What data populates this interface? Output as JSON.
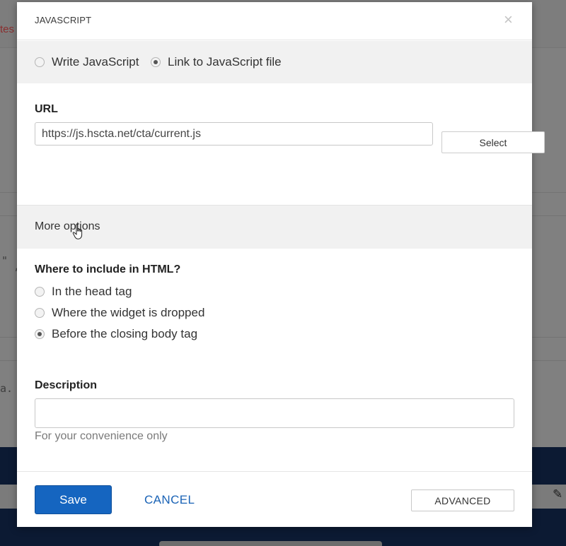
{
  "background": {
    "partial_text": "tes",
    "glyph_quote": "\"",
    "glyph_comma": ",",
    "glyph_a": "a."
  },
  "modal": {
    "title": "JAVASCRIPT",
    "close_glyph": "×",
    "source_options": [
      {
        "label": "Write JavaScript",
        "checked": false
      },
      {
        "label": "Link to JavaScript file",
        "checked": true
      }
    ],
    "url": {
      "label": "URL",
      "value": "https://js.hscta.net/cta/current.js"
    },
    "select_button": "Select",
    "more_options": "More options",
    "include": {
      "label": "Where to include in HTML?",
      "options": [
        {
          "label": "In the head tag",
          "checked": false
        },
        {
          "label": "Where the widget is dropped",
          "checked": false
        },
        {
          "label": "Before the closing body tag",
          "checked": true
        }
      ]
    },
    "description": {
      "label": "Description",
      "value": "",
      "helper": "For your convenience only"
    },
    "footer": {
      "save": "Save",
      "cancel": "CANCEL",
      "advanced": "ADVANCED"
    }
  },
  "colors": {
    "primary": "#1565c0",
    "link": "#1a63b6",
    "overlay": "#808080",
    "footer_band": "#0c1a33"
  }
}
